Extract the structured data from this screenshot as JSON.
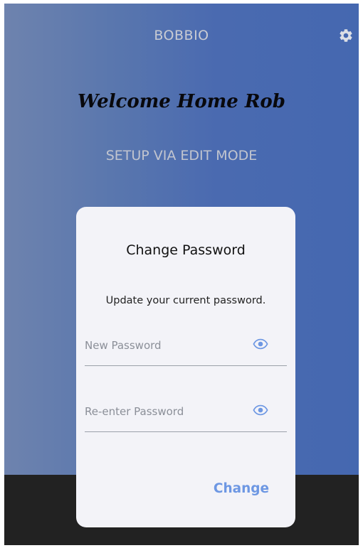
{
  "app": {
    "title": "BOBBIO",
    "welcome": "Welcome Home Rob",
    "setup_link": "SETUP VIA EDIT MODE",
    "settings_icon": "gear-icon"
  },
  "dialog": {
    "title": "Change Password",
    "message": "Update your current password.",
    "new_password": {
      "placeholder": "New Password",
      "value": "",
      "icon": "eye-icon"
    },
    "reenter_password": {
      "placeholder": "Re-enter Password",
      "value": "",
      "icon": "eye-icon"
    },
    "submit_label": "Change"
  },
  "colors": {
    "accent": "#6d97e3",
    "background_gradient_start": "#6e83ae",
    "background_gradient_end": "#4568b0",
    "dialog_background": "#f3f3f8",
    "bottom_bar": "#222222"
  }
}
